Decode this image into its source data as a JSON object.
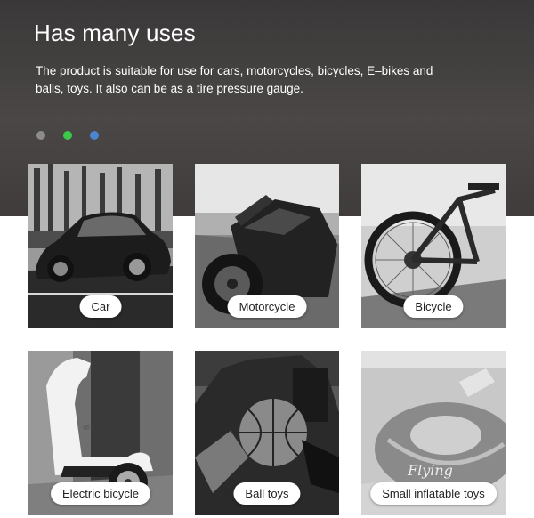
{
  "header": {
    "title": "Has many uses",
    "description": "The product is suitable for use for cars, motorcycles, bicycles, E–bikes and balls, toys. It also can be as a tire pressure gauge."
  },
  "carousel": {
    "dots": [
      {
        "color": "#8c8c8c"
      },
      {
        "color": "#3cc84a"
      },
      {
        "color": "#4a86cf"
      }
    ]
  },
  "tiles": [
    {
      "label": "Car"
    },
    {
      "label": "Motorcycle"
    },
    {
      "label": "Bicycle"
    },
    {
      "label": "Electric bicycle"
    },
    {
      "label": "Ball toys"
    },
    {
      "label": "Small inflatable toys"
    }
  ]
}
